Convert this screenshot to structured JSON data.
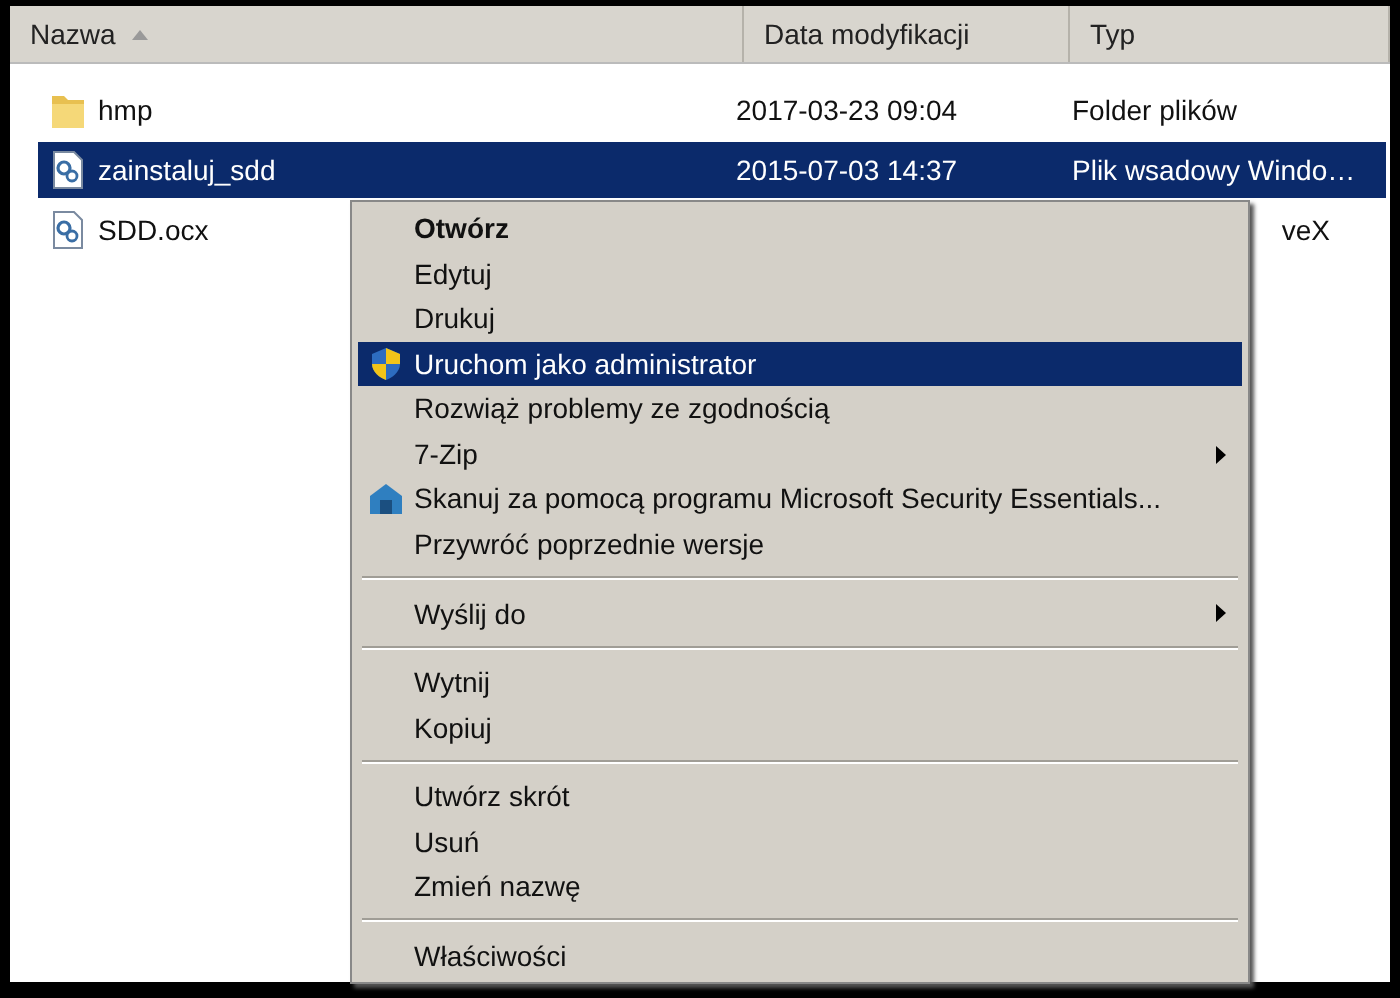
{
  "columns": [
    {
      "label": "Nazwa",
      "sorted": true
    },
    {
      "label": "Data modyfikacji",
      "sorted": false
    },
    {
      "label": "Typ",
      "sorted": false
    }
  ],
  "files": [
    {
      "kind": "folder",
      "name": "hmp",
      "date": "2017-03-23 09:04",
      "type": "Folder plików",
      "selected": false
    },
    {
      "kind": "script",
      "name": "zainstaluj_sdd",
      "date": "2015-07-03 14:37",
      "type": "Plik wsadowy Windo…",
      "selected": true
    },
    {
      "kind": "script",
      "name": "SDD.ocx",
      "type": "veX",
      "selected": false
    }
  ],
  "context_menu": [
    {
      "kind": "item",
      "label": "Otwórz",
      "bold": true,
      "selected": false
    },
    {
      "kind": "item",
      "label": "Edytuj",
      "selected": false
    },
    {
      "kind": "item",
      "label": "Drukuj",
      "selected": false
    },
    {
      "kind": "shield-item",
      "label": "Uruchom jako administrator",
      "selected": true
    },
    {
      "kind": "item",
      "label": "Rozwiąż problemy ze zgodnością",
      "selected": false
    },
    {
      "kind": "item",
      "label": "7-Zip",
      "submenu": true,
      "selected": false
    },
    {
      "kind": "scanner-item",
      "label": "Skanuj za pomocą programu Microsoft Security Essentials...",
      "selected": false
    },
    {
      "kind": "item",
      "label": "Przywróć poprzednie wersje",
      "selected": false
    },
    {
      "kind": "separator"
    },
    {
      "kind": "item",
      "label": "Wyślij do",
      "submenu": true,
      "selected": false
    },
    {
      "kind": "separator"
    },
    {
      "kind": "item",
      "label": "Wytnij",
      "selected": false
    },
    {
      "kind": "item",
      "label": "Kopiuj",
      "selected": false
    },
    {
      "kind": "separator"
    },
    {
      "kind": "item",
      "label": "Utwórz skrót",
      "selected": false
    },
    {
      "kind": "item",
      "label": "Usuń",
      "selected": false
    },
    {
      "kind": "item",
      "label": "Zmień nazwę",
      "selected": false
    },
    {
      "kind": "separator"
    },
    {
      "kind": "item",
      "label": "Właściwości",
      "selected": false
    }
  ]
}
